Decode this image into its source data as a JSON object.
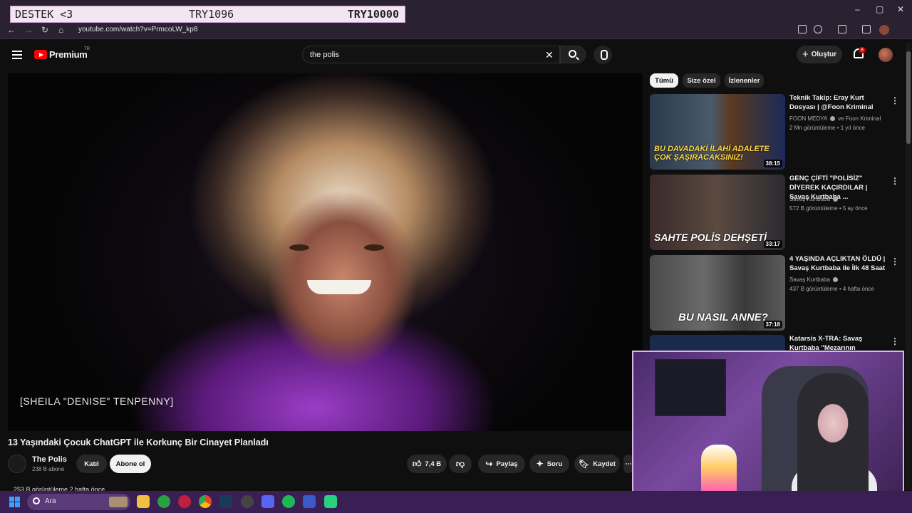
{
  "browser": {
    "url": "youtube.com/watch?v=PrmcoLW_kp8",
    "window_controls": [
      "–",
      "▢",
      "✕"
    ],
    "nav": [
      "←",
      "→",
      "↻",
      "⌂"
    ]
  },
  "overlay_banner": {
    "left": "DESTEK <3",
    "middle": "TRY1096",
    "right": "TRY10000"
  },
  "header": {
    "logo_text": "Premium",
    "logo_region": "TR",
    "search_value": "the polis",
    "create_label": "Oluştur",
    "notification_count": "8"
  },
  "video": {
    "caption": "[SHEILA \"DENISE\" TENPENNY]",
    "title": "13 Yaşındaki Çocuk ChatGPT ile Korkunç Bir Cinayet Planladı",
    "channel": "The Polis",
    "subscribers": "238 B abone",
    "join_label": "Katıl",
    "subscribe_label": "Abone ol",
    "likes": "7,4 B",
    "share_label": "Paylaş",
    "ask_label": "Soru",
    "save_label": "Kaydet",
    "views": "253 B görüntüleme  2 hafta önce"
  },
  "chips": [
    {
      "label": "Tümü",
      "active": true
    },
    {
      "label": "Size özel",
      "active": false
    },
    {
      "label": "İzlenenler",
      "active": false
    }
  ],
  "recommendations": [
    {
      "title": "Teknik Takip: Eray Kurt Dosyası | @Foon Kriminal",
      "channel": "FOON MEDYA",
      "channel_extra": "ve Foon Kriminal",
      "meta": "2 Mn görüntüleme • 1 yıl önce",
      "duration": "38:15",
      "thumb_text": "BU DAVADAKİ İLAHİ ADALETE ÇOK ŞAŞIRACAKSINIZ!"
    },
    {
      "title": "GENÇ ÇİFTİ \"POLİSİZ\" DİYEREK KAÇIRDILAR | Savaş Kurtbaba ...",
      "channel": "Savaş Kurtbaba",
      "meta": "572 B görüntüleme • 5 ay önce",
      "duration": "33:17",
      "thumb_text": "SAHTE POLİS DEHŞETİ"
    },
    {
      "title": "4 YAŞINDA AÇLIKTAN ÖLDÜ | Savaş Kurtbaba ile İlk 48 Saat",
      "channel": "Savaş Kurtbaba",
      "meta": "437 B görüntüleme • 4 hafta önce",
      "duration": "37:18",
      "thumb_text": "BU NASIL ANNE?"
    },
    {
      "title": "Katarsis X-TRA: Savaş Kurtbaba \"Mezarının Açılmasına Neden ...",
      "channel": "",
      "meta": "",
      "duration": "",
      "thumb_text": ""
    }
  ],
  "taskbar": {
    "search_placeholder": "Ara"
  },
  "colors": {
    "yt_red": "#ff0000",
    "taskbar": "#3a1f55",
    "banner_bg": "#f3e6f3"
  }
}
